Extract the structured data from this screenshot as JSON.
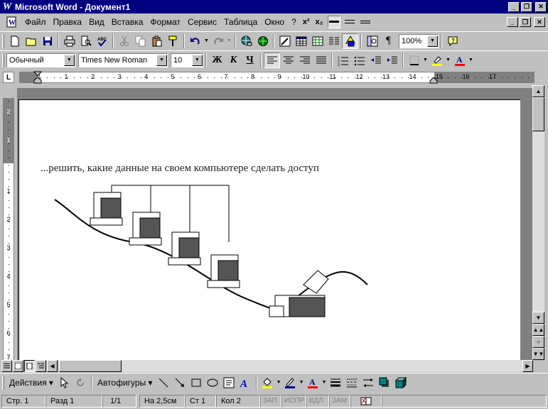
{
  "window": {
    "title": "Microsoft Word - Документ1",
    "app_icon_glyph": "W"
  },
  "menu": {
    "items": [
      {
        "label": "Файл"
      },
      {
        "label": "Правка"
      },
      {
        "label": "Вид"
      },
      {
        "label": "Вставка"
      },
      {
        "label": "Формат"
      },
      {
        "label": "Сервис"
      },
      {
        "label": "Таблица"
      },
      {
        "label": "Окно"
      },
      {
        "label": "?"
      }
    ],
    "superscript_label": "x²",
    "subscript_label": "x₂"
  },
  "standard_toolbar": {
    "zoom": "100%"
  },
  "formatting_toolbar": {
    "style": "Обычный",
    "font": "Times New Roman",
    "size": "10",
    "bold": "Ж",
    "italic": "К",
    "underline": "Ч"
  },
  "ruler": {
    "numbers": [
      "1",
      "1",
      "2",
      "3",
      "4",
      "5",
      "6",
      "7",
      "8",
      "9",
      "10",
      "11",
      "12",
      "13",
      "14",
      "15",
      "16",
      "17"
    ],
    "vertical_numbers": [
      "2",
      "1",
      "1",
      "2",
      "3",
      "4",
      "5",
      "6",
      "7"
    ],
    "corner_label": "L"
  },
  "document": {
    "text_line": "...решить, какие данные на своем компьютере сделать доступ"
  },
  "drawing_toolbar": {
    "actions_label": "Действия",
    "autoshapes_label": "Автофигуры"
  },
  "statusbar": {
    "page": "Стр. 1",
    "section": "Разд 1",
    "pages": "1/1",
    "at": "На 2,5см",
    "line": "Ст 1",
    "column": "Кол 2",
    "rec": "ЗАП",
    "trk": "ИСПР",
    "ext": "ВДЛ",
    "ovr": "ЗАМ"
  },
  "colors": {
    "titlebar": "#000080",
    "highlight": "#ffff00",
    "font_color": "#ff0000"
  }
}
